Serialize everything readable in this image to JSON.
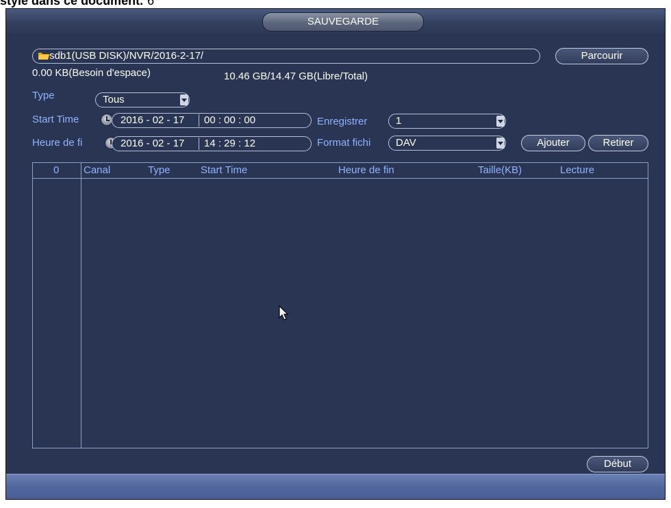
{
  "doc_caption": {
    "text": "style dans ce document.",
    "suffix": "6"
  },
  "window": {
    "title": "SAUVEGARDE"
  },
  "path": {
    "value": "sdb1(USB DISK)/NVR/2016-2-17/"
  },
  "buttons": {
    "browse": "Parcourir",
    "add": "Ajouter",
    "remove": "Retirer",
    "start": "Début"
  },
  "space": {
    "required": "0.00 KB(Besoin d'espace)",
    "free_total": "10.46 GB/14.47 GB(Libre/Total)"
  },
  "type": {
    "label": "Type",
    "value": "Tous"
  },
  "start_time": {
    "label": "Start Time",
    "date": "2016 - 02 - 17",
    "time": "00 : 00 : 00"
  },
  "end_time": {
    "label": "Heure de fi",
    "date": "2016 - 02 - 17",
    "time": "14 : 29 : 12"
  },
  "record": {
    "label": "Enregistrer",
    "value": "1"
  },
  "format": {
    "label": "Format fichi",
    "value": "DAV"
  },
  "table": {
    "columns": [
      "0",
      "Canal",
      "Type",
      "Start Time",
      "Heure de fin",
      "Taille(KB)",
      "Lecture"
    ],
    "rows": []
  },
  "icons": {
    "folder": "folder-icon",
    "clock": "clock-icon",
    "dropdown": "chevron-down-icon",
    "cursor": "mouse-cursor-icon"
  },
  "colors": {
    "panel": "#2a3453",
    "label_blue": "#8fb5ff",
    "status_bar": "#5267a0"
  }
}
